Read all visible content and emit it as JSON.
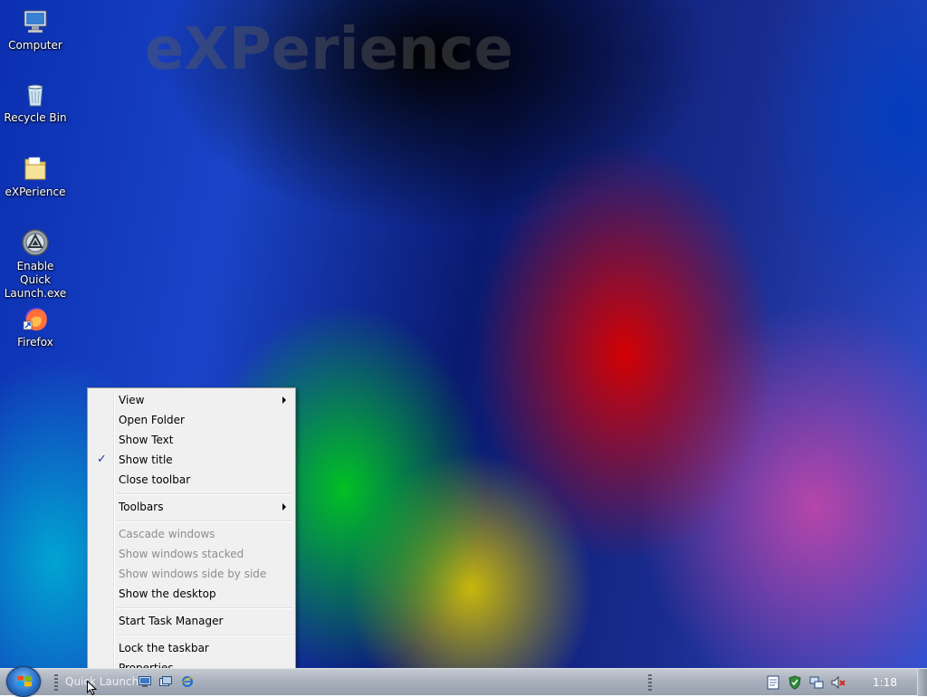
{
  "desktop": {
    "watermark": "eXPerience",
    "icons": [
      {
        "label": "Computer",
        "icon": "computer-icon"
      },
      {
        "label": "Recycle Bin",
        "icon": "recycle-bin-icon"
      },
      {
        "label": "eXPerience",
        "icon": "folder-icon"
      },
      {
        "label": "Enable Quick Launch.exe",
        "icon": "executable-icon"
      },
      {
        "label": "Firefox",
        "icon": "firefox-icon"
      }
    ]
  },
  "context_menu": {
    "items": [
      {
        "label": "View",
        "submenu": true
      },
      {
        "label": "Open Folder"
      },
      {
        "label": "Show Text"
      },
      {
        "label": "Show title",
        "checked": true
      },
      {
        "label": "Close toolbar"
      },
      {
        "label": "Toolbars",
        "submenu": true
      },
      {
        "label": "Cascade windows",
        "disabled": true
      },
      {
        "label": "Show windows stacked",
        "disabled": true
      },
      {
        "label": "Show windows side by side",
        "disabled": true
      },
      {
        "label": "Show the desktop"
      },
      {
        "label": "Start Task Manager"
      },
      {
        "label": "Lock the taskbar"
      },
      {
        "label": "Properties"
      }
    ]
  },
  "taskbar": {
    "quick_launch_title": "Quick Launch",
    "clock": "1:18",
    "tray_icons": [
      "document-icon",
      "security-shield-icon",
      "network-icon",
      "volume-muted-icon"
    ]
  },
  "colors": {
    "menu_background": "#f0f0f0",
    "disabled_text": "#8d8d8d",
    "taskbar": "#a9b1bd"
  }
}
